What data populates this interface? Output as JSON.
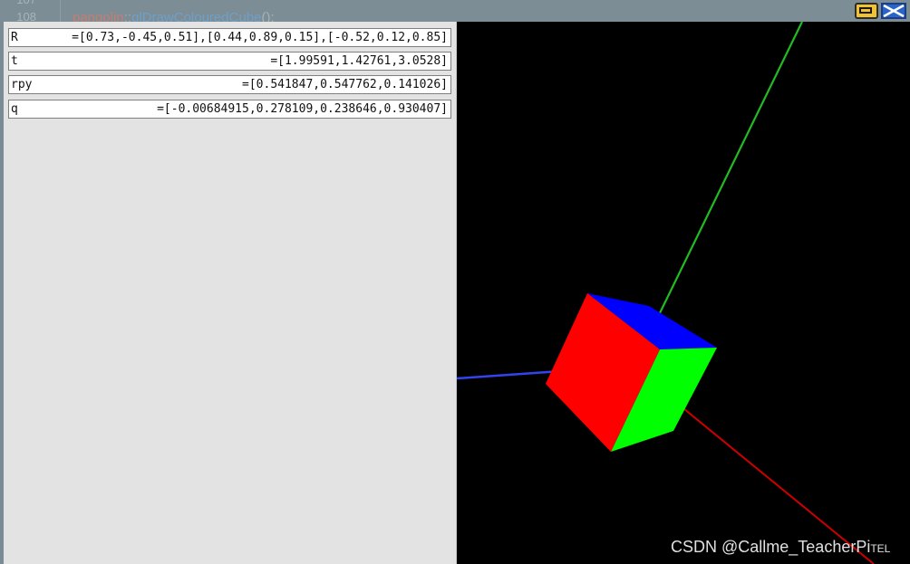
{
  "editor": {
    "line_numbers": [
      "107",
      "108"
    ],
    "code": {
      "namespace": "pangolin",
      "separator": "::",
      "function": "glDrawColouredCube",
      "suffix": "();"
    }
  },
  "window_controls": {
    "maximize_icon": "window-maximize-icon",
    "close_icon": "close-x-icon"
  },
  "panel": {
    "rows": [
      {
        "name": "R",
        "value": "=[0.73,-0.45,0.51],[0.44,0.89,0.15],[-0.52,0.12,0.85]"
      },
      {
        "name": "t",
        "value": "=[1.99591,1.42761,3.0528]"
      },
      {
        "name": "rpy",
        "value": "=[0.541847,0.547762,0.141026]"
      },
      {
        "name": "q",
        "value": "=[-0.00684915,0.278109,0.238646,0.930407]"
      }
    ]
  },
  "scene": {
    "colors": {
      "background": "#000000",
      "cube_front": "#ff0000",
      "cube_side": "#00ff00",
      "cube_top": "#0000ff",
      "axis_x": "#cc0000",
      "axis_y": "#22bb22",
      "axis_z": "#3344ee"
    }
  },
  "watermark": "CSDN @Callme_TeacherPi",
  "watermark_small": "TEL"
}
